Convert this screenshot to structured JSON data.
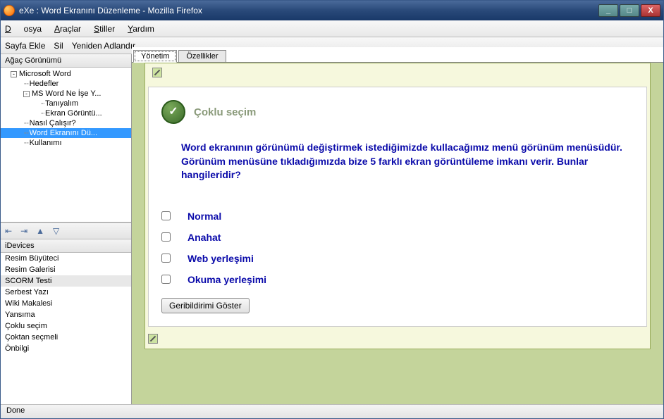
{
  "window": {
    "title": "eXe : Word Ekranını Düzenleme - Mozilla Firefox"
  },
  "menubar": {
    "items": [
      "Dosya",
      "Araçlar",
      "Stiller",
      "Yardım"
    ]
  },
  "toolbar": {
    "items": [
      "Sayfa Ekle",
      "Sil",
      "Yeniden Adlandır"
    ]
  },
  "tree": {
    "header": "Ağaç Görünümü",
    "nodes": [
      {
        "label": "Microsoft Word",
        "level": 1,
        "exp": "-"
      },
      {
        "label": "Hedefler",
        "level": 2
      },
      {
        "label": "MS Word Ne İşe Y...",
        "level": 2,
        "exp": "-"
      },
      {
        "label": "Tanıyalım",
        "level": 3
      },
      {
        "label": "Ekran Görüntü...",
        "level": 3
      },
      {
        "label": "Nasıl Çalışır?",
        "level": 2
      },
      {
        "label": "Word Ekranını Dü...",
        "level": 2,
        "selected": true
      },
      {
        "label": "Kullanımı",
        "level": 2
      }
    ],
    "tool_icons": [
      "promote-icon",
      "demote-icon",
      "move-up-icon",
      "move-down-icon"
    ]
  },
  "idevices": {
    "header": "iDevices",
    "items": [
      "Resim Büyüteci",
      "Resim Galerisi",
      "SCORM Testi",
      "Serbest Yazı",
      "Wiki Makalesi",
      "Yansıma",
      "Çoklu seçim",
      "Çoktan seçmeli",
      "Önbilgi"
    ],
    "selected": "SCORM Testi"
  },
  "tabs": {
    "items": [
      "Yönetim",
      "Özellikler"
    ],
    "active": 0
  },
  "content": {
    "section_title": "Çoklu seçim",
    "question": "Word ekranının görünümü değiştirmek istediğimizde kullacağımız menü görünüm menüsüdür. Görünüm menüsüne tıkladığımızda bize 5 farklı ekran görüntüleme imkanı verir. Bunlar hangileridir?",
    "options": [
      "Normal",
      "Anahat",
      "Web yerleşimi",
      "Okuma yerleşimi"
    ],
    "feedback_button": "Geribildirimi Göster"
  },
  "statusbar": {
    "text": "Done"
  }
}
